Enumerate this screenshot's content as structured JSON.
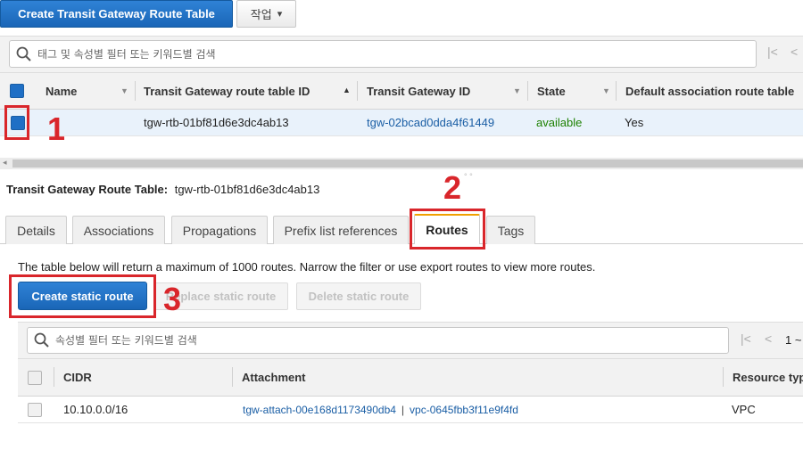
{
  "top": {
    "create_button": "Create Transit Gateway Route Table",
    "actions_button": "작업",
    "actions_chevron": "▾"
  },
  "filter": {
    "placeholder": "태그 및 속성별 필터 또는 키워드별 검색"
  },
  "main_table": {
    "headers": [
      "Name",
      "Transit Gateway route table ID",
      "Transit Gateway ID",
      "State",
      "Default association route table"
    ],
    "rows": [
      {
        "name": "",
        "route_table_id": "tgw-rtb-01bf81d6e3dc4ab13",
        "tgw_id": "tgw-02bcad0dda4f61449",
        "state": "available",
        "default_assoc": "Yes",
        "selected": true
      }
    ]
  },
  "detail": {
    "title_label": "Transit Gateway Route Table:",
    "title_value": "tgw-rtb-01bf81d6e3dc4ab13",
    "tabs": [
      "Details",
      "Associations",
      "Propagations",
      "Prefix list references",
      "Routes",
      "Tags"
    ],
    "active_tab": "Routes",
    "notice": "The table below will return a maximum of 1000 routes. Narrow the filter or use export routes to view more routes.",
    "buttons": {
      "create": "Create static route",
      "replace": "Replace static route",
      "delete": "Delete static route"
    },
    "routes_filter_placeholder": "속성별 필터 또는 키워드별 검색",
    "pager_text": "1 ~",
    "routes_table": {
      "headers": [
        "CIDR",
        "Attachment",
        "Resource typ"
      ],
      "rows": [
        {
          "cidr": "10.10.0.0/16",
          "attachment_id": "tgw-attach-00e168d1173490db4",
          "separator": "|",
          "vpc_id": "vpc-0645fbb3f11e9f4fd",
          "resource_type": "VPC"
        }
      ]
    }
  },
  "annotations": [
    "1",
    "2",
    "3"
  ],
  "colors": {
    "primary": "#1a66b7",
    "annotation_red": "#d9262b",
    "link": "#1a5ea5",
    "available": "#1d8102",
    "active_tab_top": "#f0a000"
  }
}
